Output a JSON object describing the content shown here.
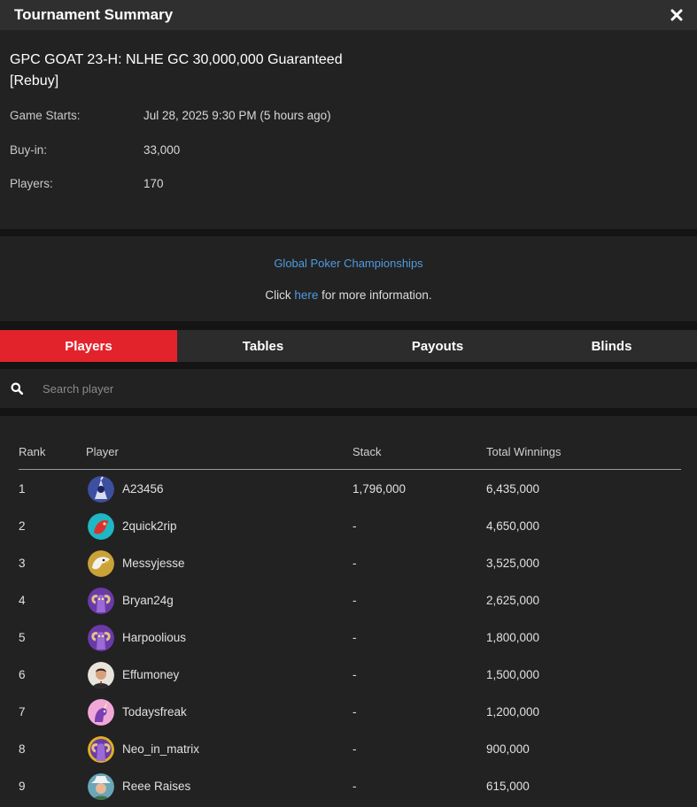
{
  "window": {
    "title": "Tournament Summary",
    "close_icon": "close-icon"
  },
  "tournament": {
    "name_line1": "GPC GOAT 23-H: NLHE GC 30,000,000 Guaranteed",
    "name_line2": "[Rebuy]",
    "game_starts_label": "Game Starts:",
    "game_starts_value": "Jul 28, 2025 9:30 PM (5 hours ago)",
    "buyin_label": "Buy-in:",
    "buyin_value": "33,000",
    "players_label": "Players:",
    "players_value": "170"
  },
  "promo": {
    "link": "Global Poker Championships",
    "text_before": "Click ",
    "here": "here",
    "text_after": " for more information."
  },
  "tabs": [
    {
      "label": "Players",
      "active": true
    },
    {
      "label": "Tables",
      "active": false
    },
    {
      "label": "Payouts",
      "active": false
    },
    {
      "label": "Blinds",
      "active": false
    }
  ],
  "search": {
    "placeholder": "Search player",
    "value": ""
  },
  "table": {
    "headers": {
      "rank": "Rank",
      "player": "Player",
      "stack": "Stack",
      "winnings": "Total Winnings"
    },
    "rows": [
      {
        "rank": "1",
        "player": "A23456",
        "stack": "1,796,000",
        "winnings": "6,435,000",
        "avatar": "wizard-avatar"
      },
      {
        "rank": "2",
        "player": "2quick2rip",
        "stack": "-",
        "winnings": "4,650,000",
        "avatar": "dragon-avatar"
      },
      {
        "rank": "3",
        "player": "Messyjesse",
        "stack": "-",
        "winnings": "3,525,000",
        "avatar": "eagle-avatar"
      },
      {
        "rank": "4",
        "player": "Bryan24g",
        "stack": "-",
        "winnings": "2,625,000",
        "avatar": "ram-avatar"
      },
      {
        "rank": "5",
        "player": "Harpoolious",
        "stack": "-",
        "winnings": "1,800,000",
        "avatar": "ram-avatar"
      },
      {
        "rank": "6",
        "player": "Effumoney",
        "stack": "-",
        "winnings": "1,500,000",
        "avatar": "man-avatar"
      },
      {
        "rank": "7",
        "player": "Todaysfreak",
        "stack": "-",
        "winnings": "1,200,000",
        "avatar": "unicorn-avatar"
      },
      {
        "rank": "8",
        "player": "Neo_in_matrix",
        "stack": "-",
        "winnings": "900,000",
        "avatar": "ram-avatar"
      },
      {
        "rank": "9",
        "player": "Reee Raises",
        "stack": "-",
        "winnings": "615,000",
        "avatar": "cowboy-avatar"
      }
    ]
  },
  "colors": {
    "accent_red": "#e3232b",
    "link_blue": "#4f9be0",
    "panel": "#222222",
    "background": "#141414"
  }
}
